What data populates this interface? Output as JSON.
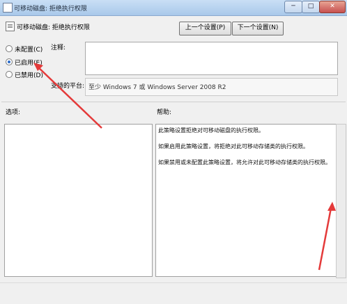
{
  "window": {
    "title": "可移动磁盘: 拒绝执行权限",
    "minimize_label": "─",
    "maximize_label": "□",
    "close_label": "✕"
  },
  "header": {
    "title": "可移动磁盘: 拒绝执行权限",
    "prev_button": "上一个设置(P)",
    "next_button": "下一个设置(N)"
  },
  "state": {
    "options": [
      {
        "label": "未配置(C)",
        "selected": false
      },
      {
        "label": "已启用(E)",
        "selected": true
      },
      {
        "label": "已禁用(D)",
        "selected": false
      }
    ]
  },
  "comment": {
    "label": "注释:",
    "value": ""
  },
  "platform": {
    "label": "支持的平台:",
    "value": "至少 Windows 7 或 Windows Server 2008 R2"
  },
  "options_pane": {
    "label": "选项:"
  },
  "help_pane": {
    "label": "帮助:",
    "paragraphs": [
      "此策略设置拒绝对可移动磁盘的执行权限。",
      "如果启用此策略设置，将拒绝对此可移动存储类的执行权限。",
      "如果禁用或未配置此策略设置，将允许对此可移动存储类的执行权限。"
    ]
  },
  "annotations": {
    "arrow_color": "#e43a3a"
  }
}
